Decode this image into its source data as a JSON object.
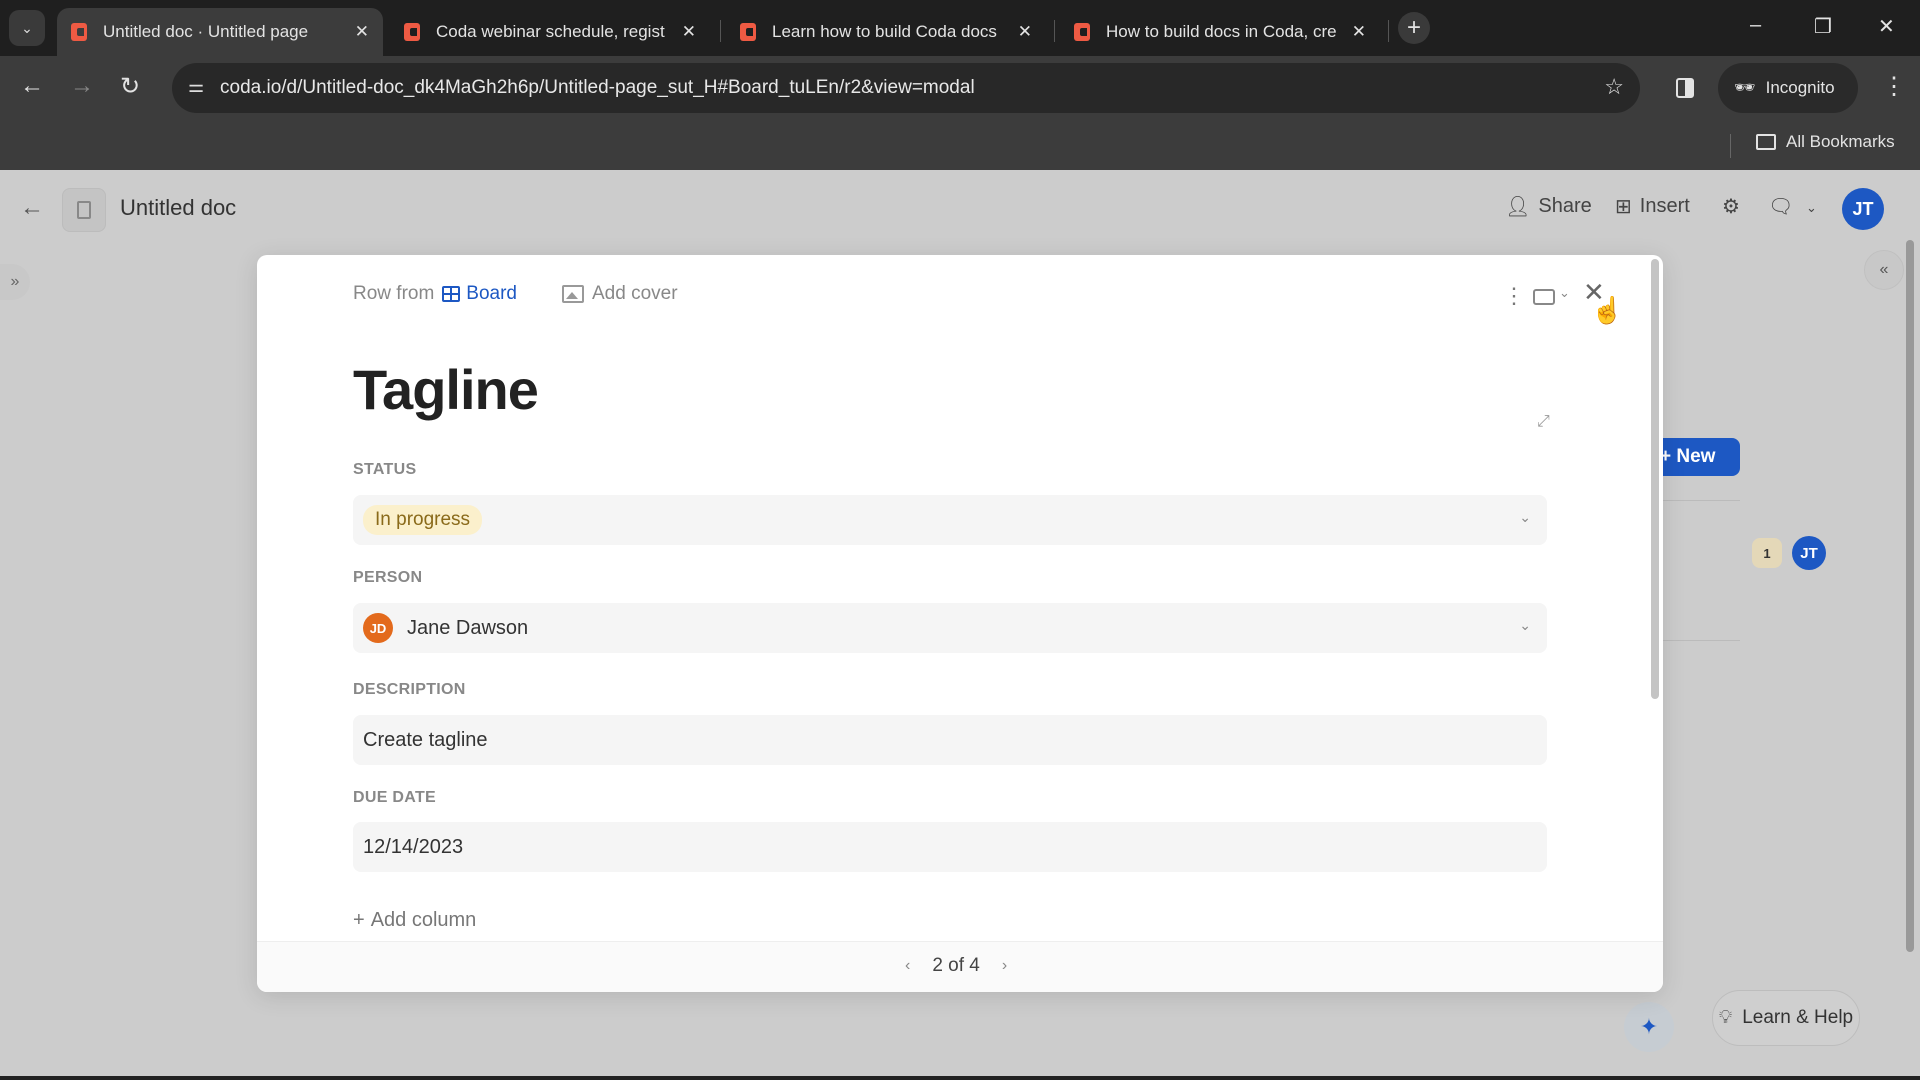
{
  "browser": {
    "tabs": [
      {
        "title": "Untitled doc · Untitled page",
        "active": true
      },
      {
        "title": "Coda webinar schedule, regist",
        "active": false
      },
      {
        "title": "Learn how to build Coda docs",
        "active": false
      },
      {
        "title": "How to build docs in Coda, cre",
        "active": false
      }
    ],
    "tab_close_glyph": "✕",
    "new_tab_glyph": "+",
    "url": "coda.io/d/Untitled-doc_dk4MaGh2h6p/Untitled-page_sut_H#Board_tuLEn/r2&view=modal",
    "incognito_label": "Incognito",
    "all_bookmarks_label": "All Bookmarks"
  },
  "app": {
    "doc_title": "Untitled doc",
    "share_label": "Share",
    "insert_label": "Insert",
    "user_initials": "JT",
    "background": {
      "new_button_label": "+ New",
      "comment_count": "1",
      "assignee_initials": "JT"
    },
    "help_label": "Learn & Help"
  },
  "modal": {
    "row_from_label": "Row from",
    "source_table": "Board",
    "add_cover_label": "Add cover",
    "title": "Tagline",
    "fields": [
      {
        "label": "STATUS",
        "value": "In progress",
        "type": "select"
      },
      {
        "label": "PERSON",
        "value": "Jane Dawson",
        "initials": "JD",
        "type": "person"
      },
      {
        "label": "DESCRIPTION",
        "value": "Create tagline",
        "type": "text"
      },
      {
        "label": "DUE DATE",
        "value": "12/14/2023",
        "type": "date"
      }
    ],
    "add_column_label": "Add column",
    "pager": {
      "current": 2,
      "total": 4,
      "text": "2 of 4"
    }
  },
  "colors": {
    "accent": "#1d58c3",
    "status_chip_bg": "#fbf0cc",
    "status_chip_text": "#8a6a1a",
    "person_avatar": "#e36a1c",
    "coda_favicon": "#ee5a43"
  }
}
